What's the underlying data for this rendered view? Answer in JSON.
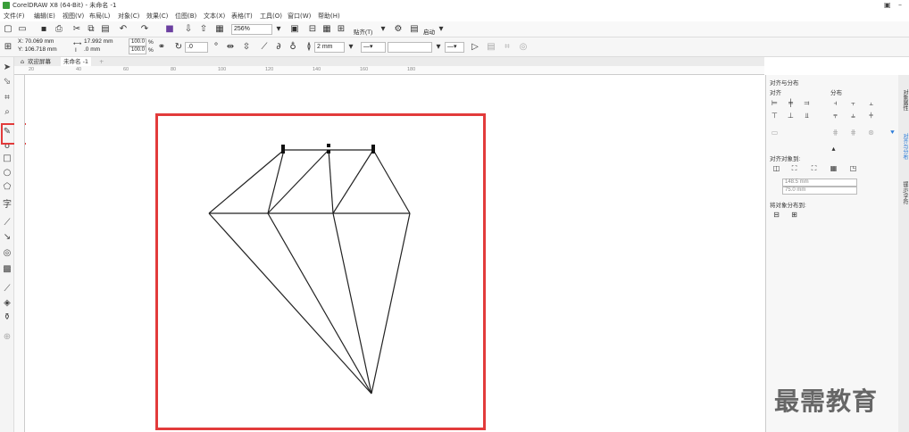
{
  "window": {
    "title": "CorelDRAW X8 (64-Bit) - 未命名 -1"
  },
  "menu": [
    "文件(F)",
    "编辑(E)",
    "视图(V)",
    "布局(L)",
    "对象(C)",
    "效果(C)",
    "位图(B)",
    "文本(X)",
    "表格(T)",
    "工具(O)",
    "窗口(W)",
    "帮助(H)"
  ],
  "standard_toolbar": {
    "zoom": "256%",
    "snap": "贴齐(T)",
    "launch": "启动"
  },
  "property_bar": {
    "x": "X: 70.069 mm",
    "y": "Y: 106.718 mm",
    "w": "17.992 mm",
    "h": ".0 mm",
    "sx": "100.0",
    "sy": "100.0",
    "pct": "%",
    "angle": ".0",
    "outline": "2 mm"
  },
  "tabs": {
    "welcome": "欢迎屏幕",
    "doc": "未命名 -1"
  },
  "ruler_marks": [
    "20",
    "40",
    "60",
    "80",
    "100",
    "120",
    "140",
    "160",
    "180"
  ],
  "docker": {
    "title": "对齐与分布",
    "align": "对齐",
    "distribute": "分布",
    "align_objects_to": "对齐对象到:",
    "x_value": "148.5 mm",
    "y_value": "75.0 mm",
    "distribute_to": "将对象分布到:"
  },
  "docker_tabs": [
    "对象属性",
    "对齐与分布",
    "提示/字符"
  ],
  "watermark": "最需教育"
}
